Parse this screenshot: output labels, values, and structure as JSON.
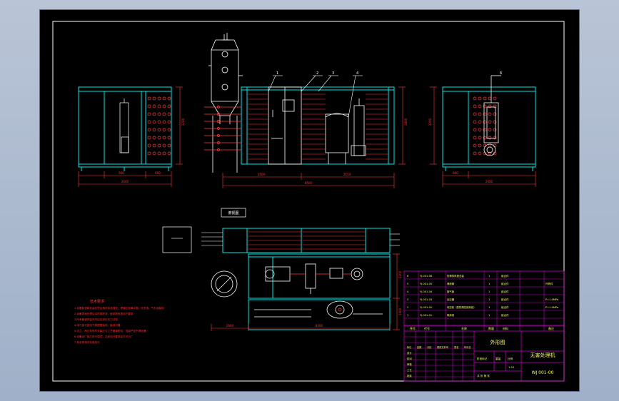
{
  "colors": {
    "background": "#000000",
    "frame": "#ffffff",
    "equipment": "#00e5e5",
    "piping": "#ff3b3b",
    "dimensions": "#ff4d4d",
    "titleblock": "#c000c0",
    "text": "#ffff66"
  },
  "views": {
    "top_label": "俯视图",
    "dims": {
      "left_width": "900",
      "left_offset": "600",
      "left_total": "2600",
      "left_height": "2200",
      "front_center": "3500",
      "front_total": "8500",
      "front_height": "2800",
      "front_mid": "2150",
      "right_total": "2600",
      "right_offset": "600",
      "right_height": "2200",
      "plan_left": "2600",
      "plan_total": "8500",
      "plan_height": "2200",
      "plan_side": "1400"
    },
    "callouts": [
      "1",
      "2",
      "3",
      "4",
      "5",
      "6"
    ]
  },
  "notes": {
    "title": "技术要求",
    "lines": [
      "1.设备制造和安装应符合相关标准规范，焊缝应饱满平整，无夹渣、气孔及裂纹",
      "2.设备表面处理后涂防锈底漆，面漆颜色按用户要求",
      "3.所有管道安装完毕后应进行压力试验",
      "4.电气部分按电气原理图接线，接地可靠",
      "5.法兰、阀门及附件安装应与工艺管道配合，连接严密不得泄漏",
      "6.设备出厂前应进行调试，达到设计要求后方可出厂",
      "7.其余按相关标准执行"
    ]
  },
  "bom": {
    "rows": [
      [
        "6",
        "YJ-001-06",
        "防爆排风罩总装",
        "1",
        "组合件",
        ""
      ],
      [
        "5",
        "YJ-001-05",
        "储液罐",
        "1",
        "组合件",
        "外购件"
      ],
      [
        "4",
        "YJ-001-04",
        "废气管",
        "1",
        "组合件",
        ""
      ],
      [
        "3",
        "YJ-001-03",
        "反应器",
        "1",
        "组合件",
        "P=1.0MPa"
      ],
      [
        "2",
        "YJ-001-02",
        "电控柜（配防爆控制系统）",
        "1",
        "组合件",
        "P=1.0MPa"
      ],
      [
        "1",
        "YJ-001-01",
        "喷淋塔",
        "1",
        "组合件",
        ""
      ]
    ],
    "header": [
      "序号",
      "代号",
      "名称",
      "数量",
      "材料",
      "备注"
    ]
  },
  "titleblock": {
    "drawing_name": "外形图",
    "product": "无害处理机",
    "drawing_number": "WJ 001-00",
    "stage": "阶段标记",
    "weight": "重量",
    "scale_label": "比例",
    "scale": "1:20",
    "sheet": "共 张 第 张",
    "roles": [
      "设计",
      "校对",
      "审核",
      "工艺",
      "批准"
    ],
    "rev_cols": [
      "标记",
      "处数",
      "分区",
      "更改文件号",
      "签名",
      "年月日"
    ]
  }
}
